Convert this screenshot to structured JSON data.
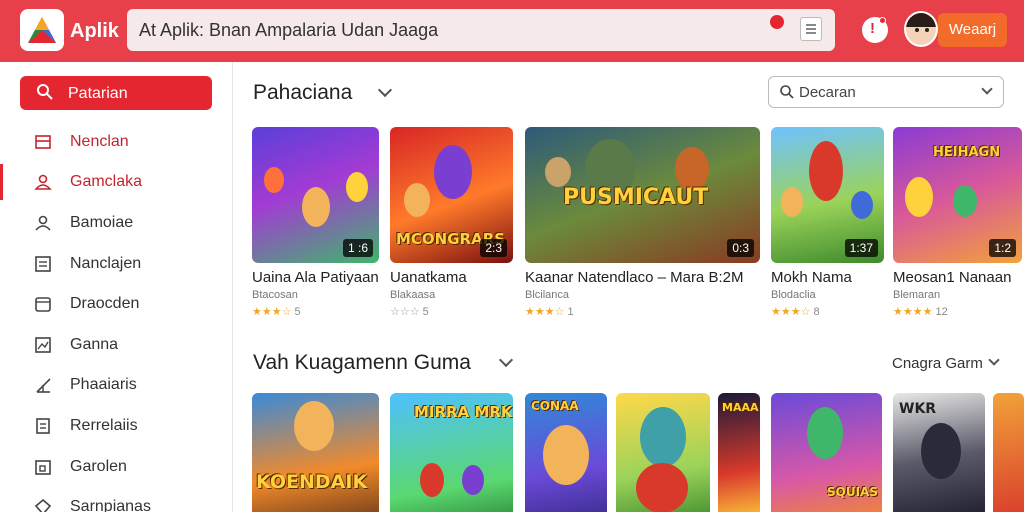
{
  "header": {
    "app_name": "Aplik",
    "search_text": "At Aplik: Bnan Ampalaria Udan Jaaga",
    "user_button": "Weaarj",
    "brand_color": "#e8404b",
    "accent_color": "#e3262f",
    "icons": [
      "app-logo-icon",
      "record-icon",
      "menu-icon",
      "notification-icon"
    ]
  },
  "sidebar": {
    "primary_button": "Patarian",
    "items": [
      {
        "label": "Nenclan",
        "icon": "inbox-icon"
      },
      {
        "label": "Gamclaka",
        "icon": "user-icon"
      },
      {
        "label": "Bamoiae",
        "icon": "person-icon"
      },
      {
        "label": "Nanclajen",
        "icon": "list-icon"
      },
      {
        "label": "Draocden",
        "icon": "folder-icon"
      },
      {
        "label": "Ganna",
        "icon": "image-icon"
      },
      {
        "label": "Phaaiaris",
        "icon": "chart-icon"
      },
      {
        "label": "Rerrelaiis",
        "icon": "document-icon"
      },
      {
        "label": "Garolen",
        "icon": "calendar-icon"
      },
      {
        "label": "Sarnpianas",
        "icon": "shield-icon"
      }
    ]
  },
  "section1": {
    "title": "Pahaciana",
    "filter_placeholder": "Decaran",
    "cards": [
      {
        "title": "Uaina Ala Patiyaan",
        "sub": "Btacosan",
        "stars": "★★★☆",
        "count": "5",
        "badge": "1 :6"
      },
      {
        "title": "Uanatkama",
        "sub": "Blakaasa",
        "stars": "☆☆☆",
        "count": "5",
        "badge": "2:3",
        "logo": "MCONGRARS"
      },
      {
        "title": "Kaanar Natendlaco – Mara B:2M",
        "sub": "Blcilanca",
        "stars": "★★★☆",
        "count": "1",
        "badge": "0:3",
        "logo": "PUSMICAUT"
      },
      {
        "title": "Mokh Nama",
        "sub": "Blodaclia",
        "stars": "★★★☆",
        "count": "8",
        "badge": "1:37"
      },
      {
        "title": "Meosan1 Nanaan",
        "sub": "Blemaran",
        "stars": "★★★★",
        "count": "12",
        "badge": "1:2",
        "logo": "HEIHAGN"
      }
    ]
  },
  "section2": {
    "title": "Vah Kuagamenn Guma",
    "sort_label": "Cnagra Garm",
    "cards": [
      {
        "logo": "KOENDAIK"
      },
      {
        "logo": "MIRRA MRKN"
      },
      {
        "logo": "CONAA"
      },
      {
        "logo": ""
      },
      {
        "logo": "MAAA"
      },
      {
        "logo": "SQUIAS"
      },
      {
        "logo": "WKR"
      },
      {
        "logo": ""
      }
    ]
  }
}
